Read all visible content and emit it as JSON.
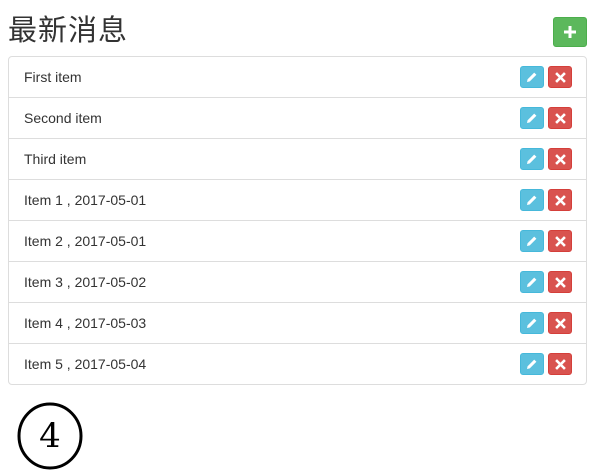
{
  "page": {
    "title": "最新消息"
  },
  "toolbar": {
    "add_icon": "plus-icon"
  },
  "list": {
    "items": [
      {
        "label": "First item"
      },
      {
        "label": "Second item"
      },
      {
        "label": "Third item"
      },
      {
        "label": "Item 1 , 2017-05-01"
      },
      {
        "label": "Item 2 , 2017-05-01"
      },
      {
        "label": "Item 3 , 2017-05-02"
      },
      {
        "label": "Item 4 , 2017-05-03"
      },
      {
        "label": "Item 5 , 2017-05-04"
      }
    ],
    "edit_icon": "pencil-icon",
    "delete_icon": "remove-icon"
  },
  "pagination": {
    "current_page": "4"
  },
  "colors": {
    "add": "#5cb85c",
    "edit": "#5bc0de",
    "delete": "#d9534f",
    "border": "#dddddd"
  }
}
